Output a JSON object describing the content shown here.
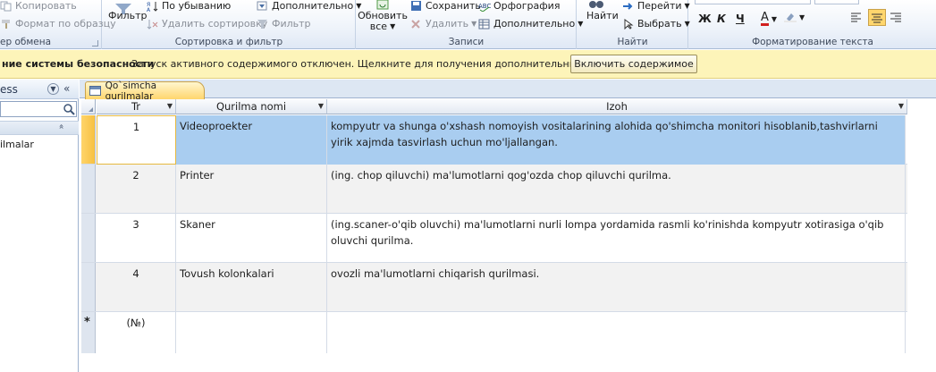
{
  "ribbon": {
    "clipboard": {
      "copy": "Копировать",
      "format_painter": "Формат по образцу",
      "group_label": "ер обмена"
    },
    "sort_filter": {
      "filter": "Фильтр",
      "descending": "По убыванию",
      "remove_sort": "Удалить сортировку",
      "filter_toggle": "Фильтр",
      "advanced": "Дополнительно",
      "group_label": "Сортировка и фильтр"
    },
    "records": {
      "refresh_all_line1": "Обновить",
      "refresh_all_line2": "все",
      "save": "Сохранить",
      "delete": "Удалить",
      "spelling": "Орфография",
      "more": "Дополнительно",
      "group_label": "Записи"
    },
    "find": {
      "find": "Найти",
      "goto": "Перейти",
      "select": "Выбрать",
      "group_label": "Найти"
    },
    "text_format": {
      "bold": "Ж",
      "italic": "К",
      "underline": "Ч",
      "font_color_letter": "A",
      "group_label": "Форматирование текста"
    }
  },
  "security_bar": {
    "title": "ние системы безопасности",
    "message": "Запуск активного содержимого отключен. Щелкните для получения дополнительных сведений.",
    "button": "Включить содержимое"
  },
  "nav_pane": {
    "title": "ess",
    "collapse": "«",
    "group_chevron": "»",
    "item": "ilmalar"
  },
  "document": {
    "tab_label": "Qo`simcha qurilmalar"
  },
  "table": {
    "columns": [
      "Tr",
      "Qurilma nomi",
      "Izoh"
    ],
    "rows": [
      {
        "tr": "1",
        "name": "Videoproekter",
        "izoh": "kompyutr va shunga o'xshash nomoyish vositalarining alohida qo'shimcha monitori hisoblanib,tashvirlarni yirik xajmda tasvirlash uchun mo'ljallangan."
      },
      {
        "tr": "2",
        "name": "Printer",
        "izoh": "(ing. chop qiluvchi) ma'lumotlarni qog'ozda chop qiluvchi qurilma."
      },
      {
        "tr": "3",
        "name": "Skaner",
        "izoh": "(ing.scaner-o'qib oluvchi) ma'lumotlarni nurli lompa yordamida rasmli ko'rinishda kompyutr xotirasiga o'qib oluvchi qurilma."
      },
      {
        "tr": "4",
        "name": "Tovush kolonkalari",
        "izoh": "ovozli ma'lumotlarni chiqarish qurilmasi."
      }
    ],
    "new_row": {
      "marker": "*",
      "tr": "(№)"
    }
  },
  "colors": {
    "selected_row": "#a9cdf0",
    "alt_row": "#f2f2f2",
    "security_bar": "#fdf4b9",
    "tab_active": "#ffd66d"
  }
}
